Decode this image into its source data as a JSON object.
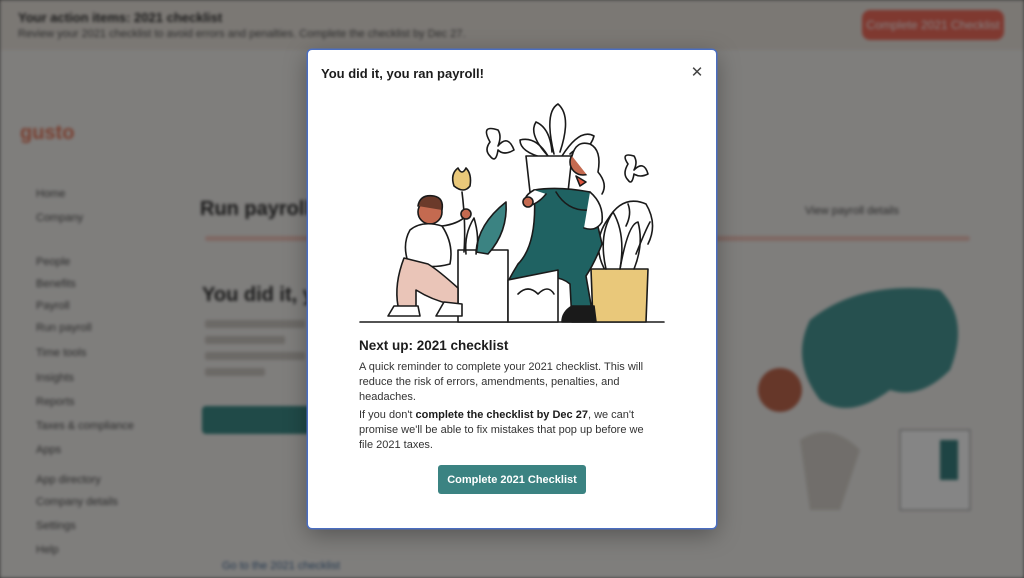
{
  "background": {
    "banner_title": "Your action items: 2021 checklist",
    "banner_text": "Review your 2021 checklist to avoid errors and penalties. Complete the checklist by Dec 27.",
    "banner_button": "Complete 2021 Checklist",
    "logo": "gusto",
    "sidebar": [
      "Home",
      "Company",
      "People",
      "Benefits",
      "Payroll",
      "Run payroll",
      "Time tools",
      "Insights",
      "Reports",
      "Taxes & compliance",
      "Apps",
      "App directory",
      "Company details",
      "Settings",
      "Help"
    ],
    "main_title": "Run payroll",
    "right_link": "View payroll details",
    "sub_title": "You did it, you ran payroll!",
    "link_text": "Go to the 2021 checklist"
  },
  "modal": {
    "title": "You did it, you ran payroll!",
    "close_icon": "close-icon",
    "illustration": "payroll-celebration-illustration",
    "heading": "Next up: 2021 checklist",
    "paragraph1": "A quick reminder to complete your 2021 checklist. This will reduce the risk of errors, amendments, penalties, and headaches.",
    "paragraph2_prefix": "If you don't ",
    "paragraph2_bold": "complete the checklist by Dec 27",
    "paragraph2_suffix": ", we can't promise we'll be able to fix mistakes that pop up before we file 2021 taxes.",
    "cta_label": "Complete 2021 Checklist"
  },
  "colors": {
    "accent": "#3b8382",
    "banner_button": "#f46d5d",
    "overlay": "rgba(0,0,0,0.48)",
    "mustard": "#e9c87a",
    "teal_dark": "#1f6262"
  }
}
